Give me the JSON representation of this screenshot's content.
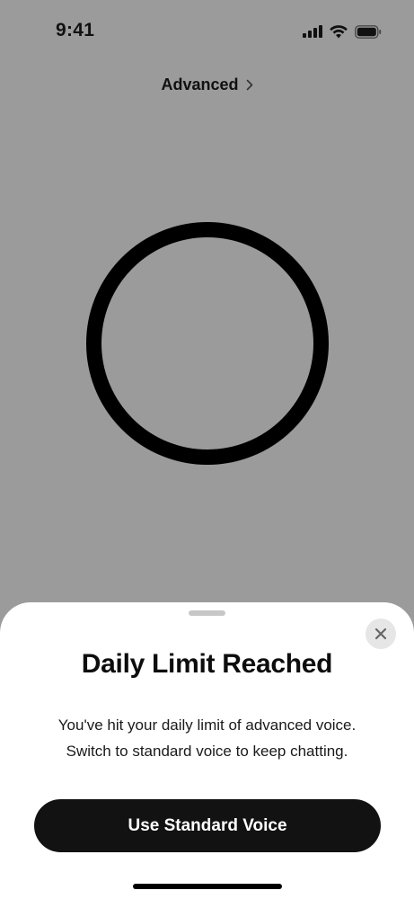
{
  "status_bar": {
    "time": "9:41",
    "icons": [
      "cellular-signal-icon",
      "wifi-icon",
      "battery-icon"
    ]
  },
  "mode_link": {
    "label": "Advanced",
    "icon": "chevron-right-icon"
  },
  "sheet": {
    "title": "Daily Limit Reached",
    "message_line_1": "You've hit your daily limit of advanced voice.",
    "message_line_2": "Switch to standard voice to keep chatting.",
    "button_label": "Use Standard Voice",
    "close_icon": "close-icon"
  },
  "colors": {
    "background": "#9b9b9b",
    "sheet": "#ffffff",
    "button": "#121212",
    "button_text": "#ffffff",
    "orb_ring": "#000000",
    "close_bg": "#e6e6e6"
  }
}
